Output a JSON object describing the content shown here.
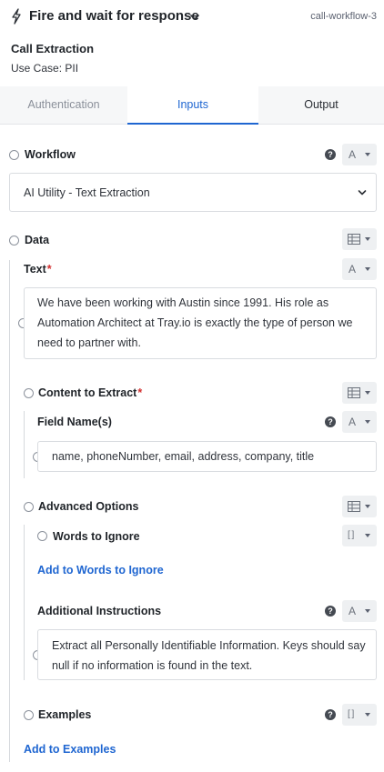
{
  "header": {
    "title": "Fire and wait for response",
    "workflow_id": "call-workflow-3",
    "call_title": "Call Extraction",
    "use_case": "Use Case: PII",
    "bolt_icon": "bolt-icon",
    "chevron_icon": "chevron-down-icon"
  },
  "tabs": [
    {
      "label": "Authentication",
      "active": false
    },
    {
      "label": "Inputs",
      "active": true
    },
    {
      "label": "Output",
      "active": false
    }
  ],
  "fields": {
    "workflow": {
      "label": "Workflow",
      "type_glyph": "A",
      "selected": "AI Utility - Text Extraction"
    },
    "data": {
      "label": "Data"
    },
    "text": {
      "label": "Text",
      "required_mark": "*",
      "type_glyph": "A",
      "value": "We have been working with Austin since 1991. His role as Automation Architect at Tray.io is exactly the type of person we need to partner with."
    },
    "content_to_extract": {
      "label": "Content to Extract",
      "required_mark": "*"
    },
    "field_names": {
      "label": "Field Name(s)",
      "type_glyph": "A",
      "value": "name, phoneNumber, email, address, company, title"
    },
    "advanced_options": {
      "label": "Advanced Options"
    },
    "words_to_ignore": {
      "label": "Words to Ignore",
      "type_glyph": "[ ]",
      "add_link": "Add to Words to Ignore"
    },
    "additional_instructions": {
      "label": "Additional Instructions",
      "type_glyph": "A",
      "value": "Extract all Personally Identifiable Information. Keys should say null if no information is found in the text."
    },
    "examples": {
      "label": "Examples",
      "type_glyph": "[ ]",
      "add_link": "Add to Examples"
    }
  },
  "help_glyph": "?",
  "colors": {
    "accent": "#1f66d1",
    "required": "#d32f2f",
    "tab_bar": "#f6f7f8"
  }
}
